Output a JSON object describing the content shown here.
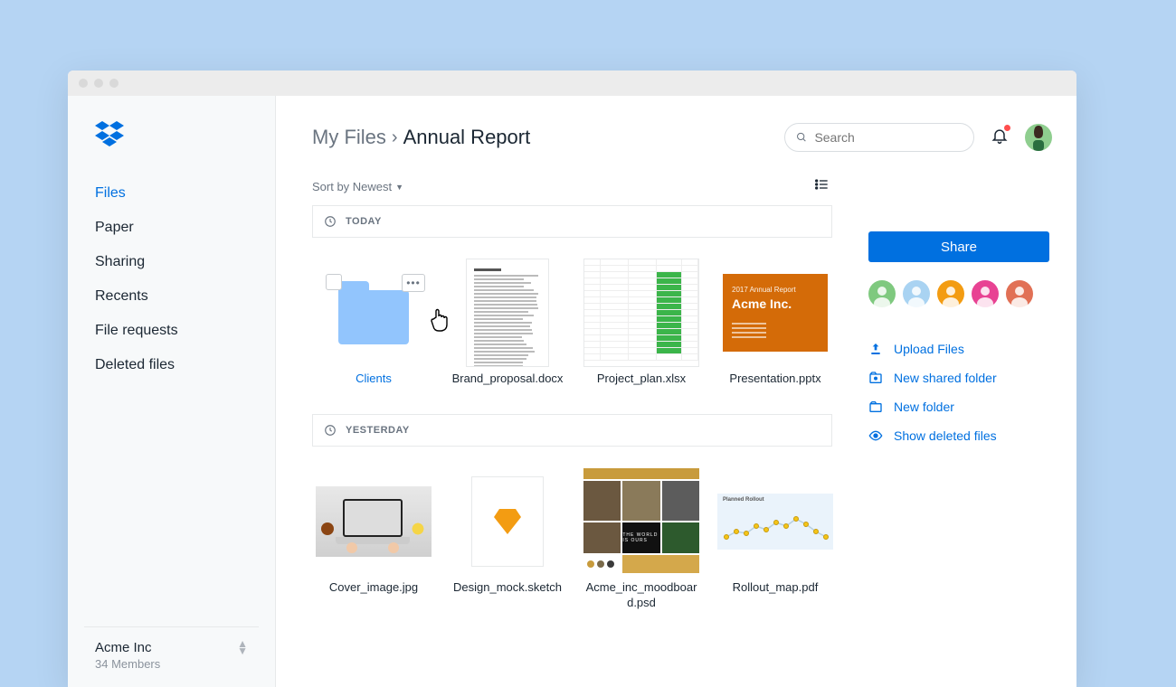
{
  "sidebar": {
    "nav": [
      {
        "label": "Files",
        "active": true
      },
      {
        "label": "Paper",
        "active": false
      },
      {
        "label": "Sharing",
        "active": false
      },
      {
        "label": "Recents",
        "active": false
      },
      {
        "label": "File requests",
        "active": false
      },
      {
        "label": "Deleted files",
        "active": false
      }
    ],
    "team_name": "Acme Inc",
    "team_members": "34 Members"
  },
  "header": {
    "breadcrumb_root": "My Files",
    "breadcrumb_current": "Annual Report",
    "search_placeholder": "Search"
  },
  "sort": {
    "label": "Sort by Newest"
  },
  "sections": [
    {
      "key": "today",
      "heading": "TODAY"
    },
    {
      "key": "yesterday",
      "heading": "YESTERDAY"
    }
  ],
  "files": {
    "today": [
      {
        "name": "Clients",
        "type": "folder",
        "hovered": true
      },
      {
        "name": "Brand_proposal.docx",
        "type": "doc"
      },
      {
        "name": "Project_plan.xlsx",
        "type": "sheet"
      },
      {
        "name": "Presentation.pptx",
        "type": "slide",
        "slide_year": "2017 Annual Report",
        "slide_company": "Acme Inc."
      }
    ],
    "yesterday": [
      {
        "name": "Cover_image.jpg",
        "type": "photo"
      },
      {
        "name": "Design_mock.sketch",
        "type": "sketch"
      },
      {
        "name": "Acme_inc_moodboard.psd",
        "type": "moodboard"
      },
      {
        "name": "Rollout_map.pdf",
        "type": "rollout",
        "rollout_title": "Planned Rollout"
      }
    ]
  },
  "rightpanel": {
    "share_label": "Share",
    "avatars": [
      {
        "bg": "#7fc97f"
      },
      {
        "bg": "#a9d3f2"
      },
      {
        "bg": "#f39c12"
      },
      {
        "bg": "#e84393"
      },
      {
        "bg": "#e17055"
      }
    ],
    "actions": [
      {
        "icon": "upload",
        "label": "Upload Files"
      },
      {
        "icon": "shared-folder",
        "label": "New shared folder"
      },
      {
        "icon": "folder",
        "label": "New folder"
      },
      {
        "icon": "eye",
        "label": "Show deleted files"
      }
    ]
  }
}
